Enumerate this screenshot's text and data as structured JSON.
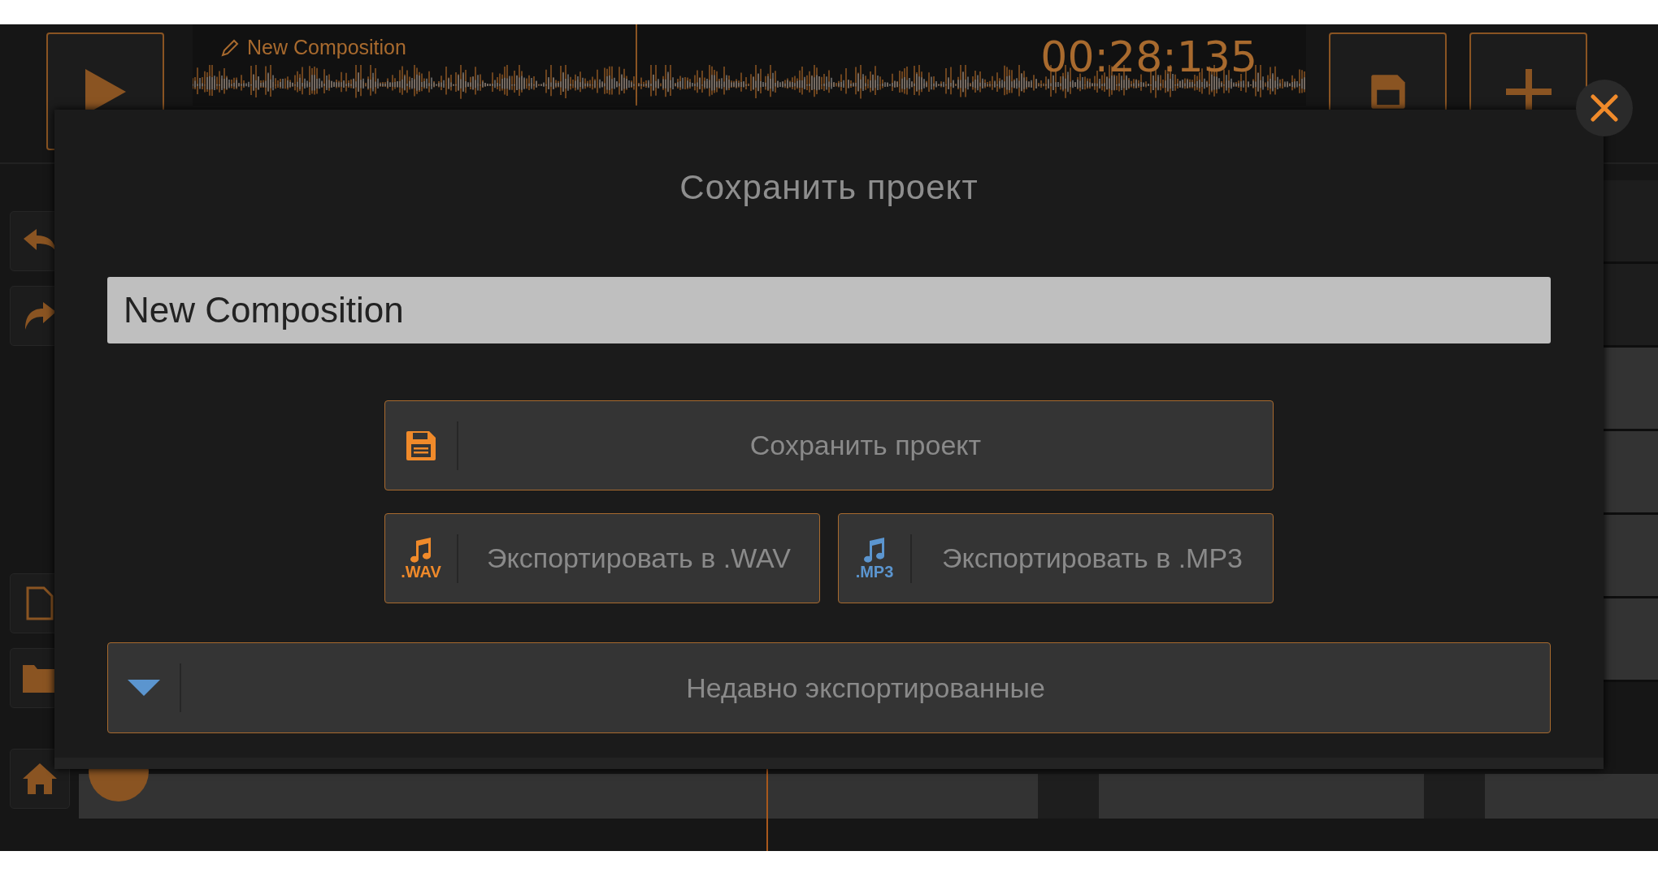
{
  "header": {
    "composition_name": "New Composition",
    "time": "00:28:135"
  },
  "dialog": {
    "title": "Сохранить проект",
    "name_field": {
      "value": "New Composition"
    },
    "buttons": [
      {
        "kind": "save",
        "label": "Сохранить проект"
      },
      {
        "kind": "wav",
        "label": "Экспортировать в .WAV",
        "icon_text": ".WAV"
      },
      {
        "kind": "mp3",
        "label": "Экспортировать в .MP3",
        "icon_text": ".MP3"
      }
    ],
    "recent": {
      "label": "Недавно экспортированные",
      "expanded": false
    }
  }
}
